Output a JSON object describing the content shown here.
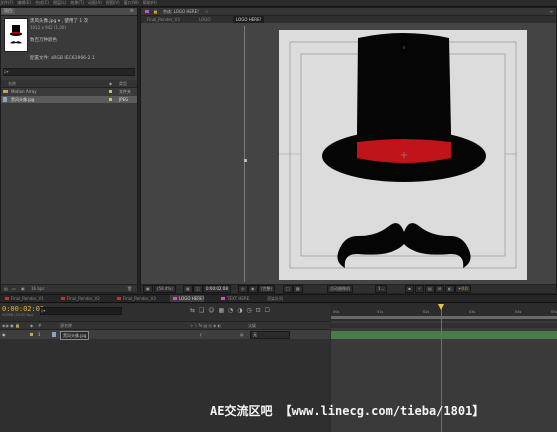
{
  "menubar": {
    "items": [
      "文件(F)",
      "编辑(E)",
      "合成(C)",
      "图层(L)",
      "效果(T)",
      "动画(A)",
      "视图(V)",
      "窗口(W)",
      "帮助(H)"
    ]
  },
  "project": {
    "tab_label": "项目",
    "file_name": "黑风头像.jpg",
    "used_count": "使用了 1 次",
    "dimensions": "1012 x 942 (1.00)",
    "color_info": "数百万种颜色",
    "profile": "配置文件: sRGB IEC61966-2.1",
    "search_placeholder": "ρ▾",
    "col_name": "名称",
    "col_label": "",
    "col_type": "类型",
    "items": [
      {
        "name": "Motion Array",
        "type": "文件夹",
        "color": "#d8c43a"
      },
      {
        "name": "黑风头像.jpg",
        "type": "JPEG",
        "color": "#d8c43a"
      }
    ],
    "bpc": "16 bpc"
  },
  "composition": {
    "panel_tab": "合成: LOGO HERE!",
    "subtabs": [
      "Final_Render_V3",
      "LOGO",
      "LOGO HERE!"
    ],
    "zoom": "(58.4%)",
    "timecode": "0:00:02:08",
    "quality": "(完整)",
    "camera": "活动摄像机",
    "views": "1...",
    "exposure": "+0.0"
  },
  "timeline": {
    "tabs": [
      {
        "label": "Final_Render_V1",
        "color": "#c83030"
      },
      {
        "label": "Final_Render_V2",
        "color": "#c83030"
      },
      {
        "label": "Final_Render_V3",
        "color": "#c83030"
      },
      {
        "label": "LOGO HERE!",
        "color": "#d04fd0",
        "active": true
      },
      {
        "label": "TEXT HERE",
        "color": "#d04fd0"
      },
      {
        "label": "渲染队列",
        "color": ""
      }
    ],
    "timecode": "0:00:02:08",
    "fps": "00058 (25.00 fps)",
    "col_name": "源名称",
    "col_parent": "父级",
    "layer_num": "1",
    "layer_name": "黑风头像.jpg",
    "layer_parent": "无",
    "ruler": [
      "00s",
      "01s",
      "02s",
      "03s",
      "04s",
      "05s"
    ],
    "colors": {
      "playhead": "#e23c3c",
      "layer_bar": "#4a7c4a",
      "work_area": "#6a6a6a"
    }
  },
  "watermark": "AE交流区吧 【www.linecg.com/tieba/1801】"
}
